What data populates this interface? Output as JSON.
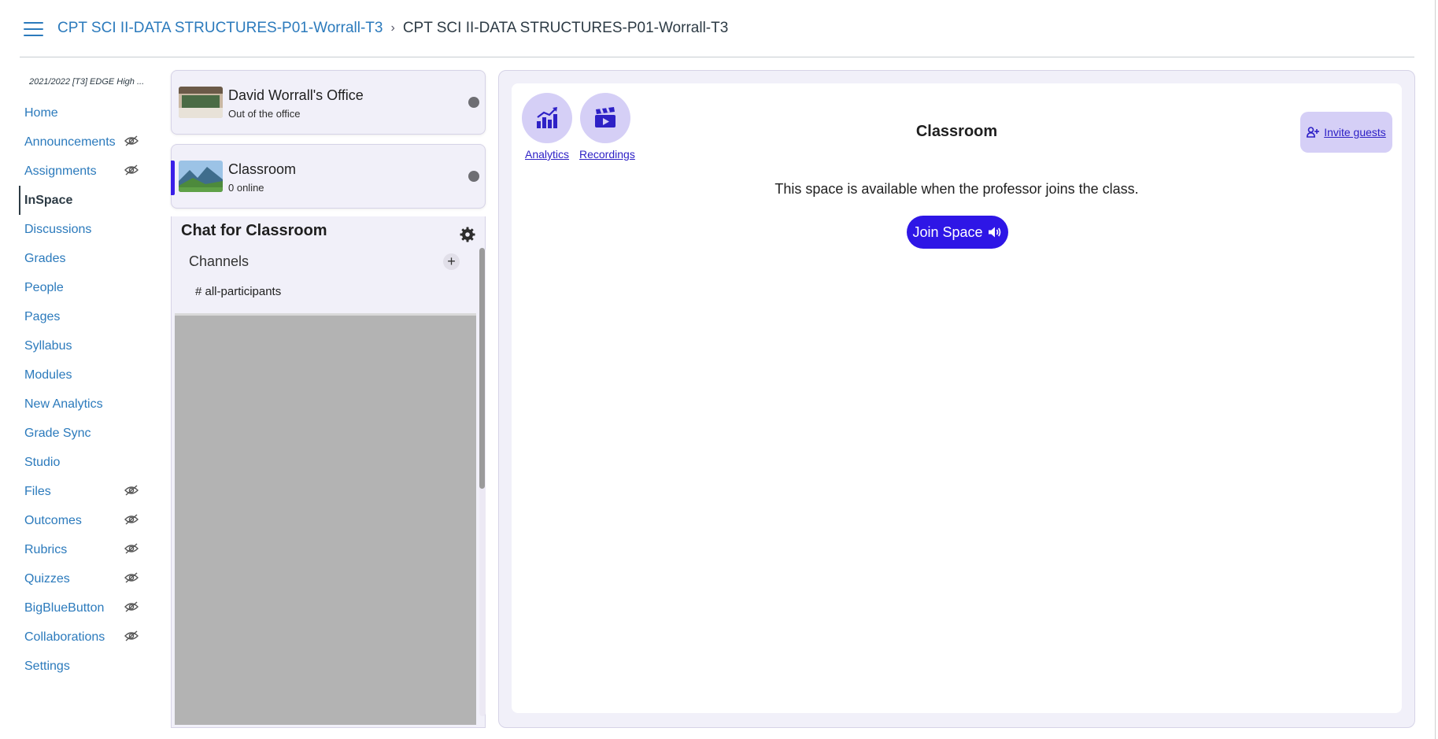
{
  "header": {
    "breadcrumb_link": "CPT SCI II-DATA STRUCTURES-P01-Worrall-T3",
    "breadcrumb_separator": "›",
    "breadcrumb_current": "CPT SCI II-DATA STRUCTURES-P01-Worrall-T3"
  },
  "sidebar": {
    "term": "2021/2022 [T3] EDGE High ...",
    "items": [
      {
        "label": "Home",
        "hidden": false
      },
      {
        "label": "Announcements",
        "hidden": true
      },
      {
        "label": "Assignments",
        "hidden": true
      },
      {
        "label": "InSpace",
        "hidden": false,
        "active": true
      },
      {
        "label": "Discussions",
        "hidden": false
      },
      {
        "label": "Grades",
        "hidden": false
      },
      {
        "label": "People",
        "hidden": false
      },
      {
        "label": "Pages",
        "hidden": false
      },
      {
        "label": "Syllabus",
        "hidden": false
      },
      {
        "label": "Modules",
        "hidden": false
      },
      {
        "label": "New Analytics",
        "hidden": false
      },
      {
        "label": "Grade Sync",
        "hidden": false
      },
      {
        "label": "Studio",
        "hidden": false
      },
      {
        "label": "Files",
        "hidden": true
      },
      {
        "label": "Outcomes",
        "hidden": true
      },
      {
        "label": "Rubrics",
        "hidden": true
      },
      {
        "label": "Quizzes",
        "hidden": true
      },
      {
        "label": "BigBlueButton",
        "hidden": true
      },
      {
        "label": "Collaborations",
        "hidden": true
      },
      {
        "label": "Settings",
        "hidden": false
      }
    ]
  },
  "spaces": {
    "office": {
      "name": "David Worrall's Office",
      "status": "Out of the office"
    },
    "classroom": {
      "name": "Classroom",
      "status": "0 online"
    }
  },
  "chat": {
    "title": "Chat for Classroom",
    "channels_label": "Channels",
    "add_symbol": "+",
    "channel": "# all-participants"
  },
  "room": {
    "title": "Classroom",
    "analytics_label": "Analytics",
    "recordings_label": "Recordings",
    "invite_label": "Invite guests",
    "availability_text": "This space is available when the professor joins the class.",
    "join_label": "Join Space"
  },
  "colors": {
    "link": "#2b7abc",
    "accent": "#2e16e6",
    "soft_accent": "#d5cff6",
    "panel_bg": "#f1f0f9"
  }
}
